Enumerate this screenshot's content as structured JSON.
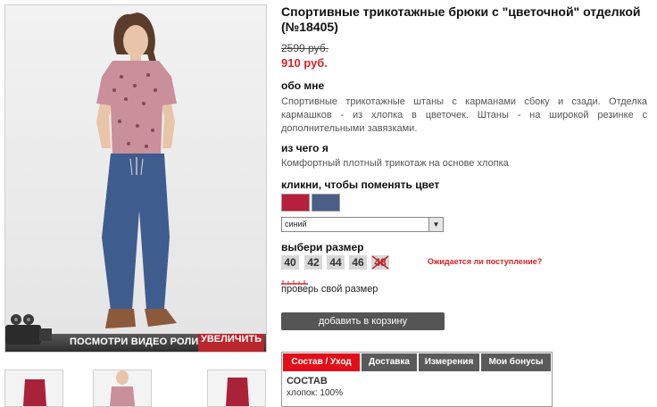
{
  "product": {
    "title": "Спортивные трикотажные брюки с \"цветочной\" отделкой (№18405)",
    "old_price": "2599 руб.",
    "new_price": "910 руб."
  },
  "about": {
    "header": "обо мне",
    "text": "Спортивные трикотажные штаны с карманами сбоку и сзади. Отделка кармашков - из хлопка в цветочек. Штаны - на широкой резинке с дополнительными завязками."
  },
  "material": {
    "header": "из чего я",
    "text": "Комфортный плотный трикотаж на основе хлопка"
  },
  "color": {
    "header": "кликни, чтобы поменять цвет",
    "swatches": [
      "#b81f3a",
      "#4a5e86"
    ],
    "selected": "синий"
  },
  "size": {
    "header": "выбери размер",
    "options": [
      "40",
      "42",
      "44",
      "46",
      "48"
    ],
    "unavailable": "48",
    "await_link": "Ожидается ли поступление?",
    "check_link": "проверь свой размер"
  },
  "cart_button": "добавить в корзину",
  "media": {
    "video_label": "ПОСМОТРИ ВИДЕО РОЛИК",
    "zoom_label": "УВЕЛИЧИТЬ"
  },
  "tabs": {
    "items": [
      "Состав / Уход",
      "Доставка",
      "Измерения",
      "Мои бонусы"
    ],
    "active": "Состав / Уход",
    "content_header": "СОСТАВ",
    "content_value": "хлопок: 100%"
  },
  "colors": {
    "accent": "#d2232a",
    "tab_active": "#e10f18",
    "tab": "#5a5a5a",
    "button": "#555555"
  }
}
